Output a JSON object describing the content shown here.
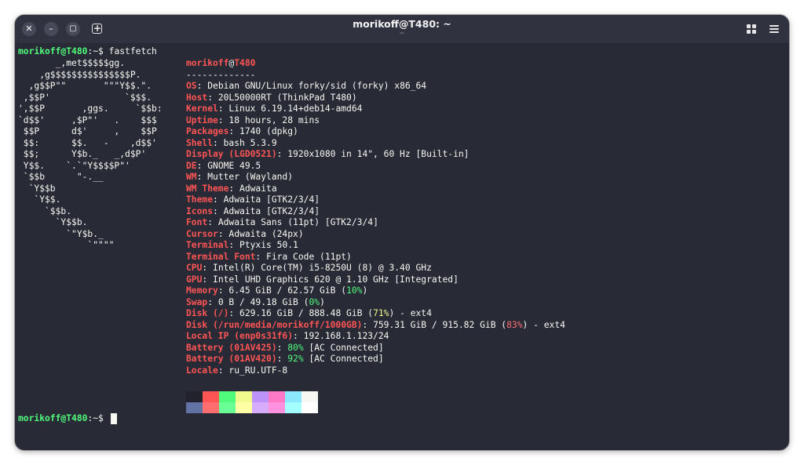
{
  "window": {
    "title": "morikoff@T480: ~",
    "subtitle": "~",
    "buttons": {
      "close": "✕",
      "minimize": "–",
      "maximize": "▢",
      "new_tab": "+"
    }
  },
  "terminal": {
    "prompt_user": "morikoff@T480",
    "prompt_suffix": ":~$",
    "command": "fastfetch",
    "logo_lines": [
      "       _,met$$$$$gg.",
      "    ,g$$$$$$$$$$$$$$$P.",
      "  ,g$$P\"\"       \"\"\"Y$$.\".",
      " ,$$P'              `$$$.",
      "',$$P       ,ggs.     `$$b:",
      "`d$$'     ,$P\"'   .    $$$",
      " $$P      d$'     ,    $$P",
      " $$:      $$.   -    ,d$$'",
      " $$;      Y$b._   _,d$P'",
      " Y$$.    `.`\"Y$$$$P\"'",
      " `$$b      \"-.__",
      "  `Y$$b",
      "   `Y$$.",
      "     `$$b.",
      "       `Y$$b.",
      "         `\"Y$b._",
      "             `\"\"\"\""
    ],
    "header_user": "morikoff",
    "header_at": "@",
    "header_host": "T480",
    "separator": "-------------",
    "info": [
      {
        "key": "OS",
        "value": "Debian GNU/Linux forky/sid (forky) x86_64"
      },
      {
        "key": "Host",
        "value": "20L50000RT (ThinkPad T480)"
      },
      {
        "key": "Kernel",
        "value": "Linux 6.19.14+deb14-amd64"
      },
      {
        "key": "Uptime",
        "value": "18 hours, 28 mins"
      },
      {
        "key": "Packages",
        "value": "1740 (dpkg)"
      },
      {
        "key": "Shell",
        "value": "bash 5.3.9"
      },
      {
        "key": "Display (LGD0521)",
        "value": "1920x1080 in 14\", 60 Hz [Built-in]"
      },
      {
        "key": "DE",
        "value": "GNOME 49.5"
      },
      {
        "key": "WM",
        "value": "Mutter (Wayland)"
      },
      {
        "key": "WM Theme",
        "value": "Adwaita"
      },
      {
        "key": "Theme",
        "value": "Adwaita [GTK2/3/4]"
      },
      {
        "key": "Icons",
        "value": "Adwaita [GTK2/3/4]"
      },
      {
        "key": "Font",
        "value": "Adwaita Sans (11pt) [GTK2/3/4]"
      },
      {
        "key": "Cursor",
        "value": "Adwaita (24px)"
      },
      {
        "key": "Terminal",
        "value": "Ptyxis 50.1"
      },
      {
        "key": "Terminal Font",
        "value": "Fira Code (11pt)"
      },
      {
        "key": "CPU",
        "value": "Intel(R) Core(TM) i5-8250U (8) @ 3.40 GHz"
      },
      {
        "key": "GPU",
        "value": "Intel UHD Graphics 620 @ 1.10 GHz [Integrated]"
      },
      {
        "key": "Memory",
        "pre": "6.45 GiB / 62.57 GiB (",
        "pct": "10%",
        "post": ")",
        "pct_color": "green"
      },
      {
        "key": "Swap",
        "pre": "0 B / 49.18 GiB (",
        "pct": "0%",
        "post": ")",
        "pct_color": "green"
      },
      {
        "key": "Disk (/)",
        "pre": "629.16 GiB / 888.48 GiB (",
        "pct": "71%",
        "post": ") - ext4",
        "pct_color": "yellow"
      },
      {
        "key": "Disk (/run/media/morikoff/1000GB)",
        "pre": "759.31 GiB / 915.82 GiB (",
        "pct": "83%",
        "post": ") - ext4",
        "pct_color": "red"
      },
      {
        "key": "Local IP (enp0s31f6)",
        "value": "192.168.1.123/24"
      },
      {
        "key": "Battery (01AV425)",
        "pre": "",
        "pct": "80%",
        "post": " [AC Connected]",
        "pct_color": "green"
      },
      {
        "key": "Battery (01AV420)",
        "pre": "",
        "pct": "92%",
        "post": " [AC Connected]",
        "pct_color": "green"
      },
      {
        "key": "Locale",
        "value": "ru_RU.UTF-8"
      }
    ],
    "palette_top": [
      "#21222c",
      "#ff5555",
      "#50fa7b",
      "#f1fa8c",
      "#bd93f9",
      "#ff79c6",
      "#8be9fd",
      "#f8f8f2"
    ],
    "palette_bottom": [
      "#6272a4",
      "#ff6e6e",
      "#69ff94",
      "#ffffa5",
      "#d6acff",
      "#ff92df",
      "#a4ffff",
      "#ffffff"
    ]
  },
  "colors": {
    "background": "#282a36",
    "titlebar": "#30323f",
    "prompt_green": "#50fa7b",
    "key_red": "#ff5555"
  }
}
